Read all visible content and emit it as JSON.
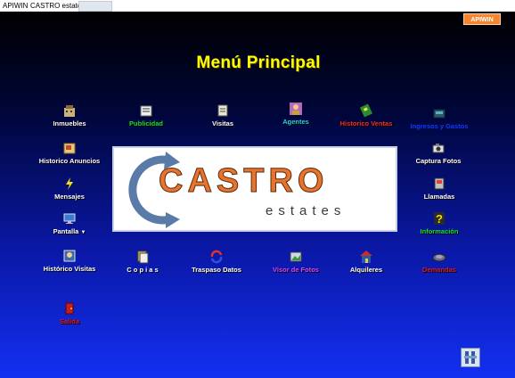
{
  "titlebar": {
    "app": "APIWIN",
    "window": "CASTRO estates"
  },
  "top_button": "APIWIN",
  "main_title": "Menú Principal",
  "logo": {
    "word": "CASTRO",
    "sub": "estates"
  },
  "menu": {
    "inmuebles": "Inmuebles",
    "publicidad": "Publicidad",
    "visitas": "Visitas",
    "agentes": "Agentes",
    "historico_ventas": "Historico Ventas",
    "ingresos_gastos": "Ingresos y Gastos",
    "historico_anuncios": "Historico Anuncios",
    "captura_fotos": "Captura Fotos",
    "mensajes": "Mensajes",
    "llamadas": "Llamadas",
    "pantalla": "Pantalla",
    "informacion": "Información",
    "historico_visitas": "Histórico Visitas",
    "copias": "C o p i a s",
    "traspaso_datos": "Traspaso Datos",
    "visor_fotos": "Visor de Fotos",
    "alquileres": "Alquileres",
    "demandas": "Demandas",
    "salida": "Salida"
  }
}
